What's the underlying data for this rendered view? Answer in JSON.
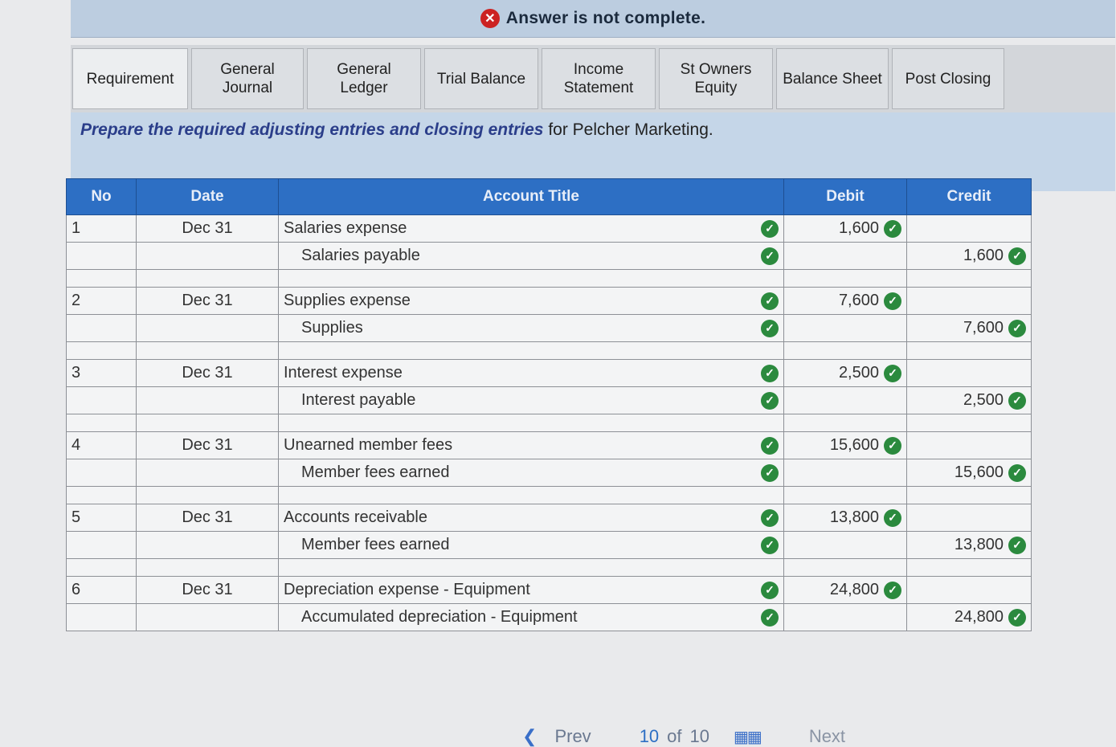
{
  "banner": {
    "message": "Answer is not complete."
  },
  "tabs": [
    {
      "label": "Requirement",
      "active": true
    },
    {
      "label": "General Journal"
    },
    {
      "label": "General Ledger"
    },
    {
      "label": "Trial Balance"
    },
    {
      "label": "Income Statement"
    },
    {
      "label": "St Owners Equity"
    },
    {
      "label": "Balance Sheet"
    },
    {
      "label": "Post Closing"
    }
  ],
  "instructions": {
    "emphasis": "Prepare the required adjusting entries and closing entries",
    "rest": " for Pelcher Marketing."
  },
  "table": {
    "headers": {
      "no": "No",
      "date": "Date",
      "account": "Account Title",
      "debit": "Debit",
      "credit": "Credit"
    },
    "entries": [
      {
        "no": "1",
        "date": "Dec 31",
        "debit_account": "Salaries expense",
        "credit_account": "Salaries payable",
        "amount": "1,600"
      },
      {
        "no": "2",
        "date": "Dec 31",
        "debit_account": "Supplies expense",
        "credit_account": "Supplies",
        "amount": "7,600"
      },
      {
        "no": "3",
        "date": "Dec 31",
        "debit_account": "Interest expense",
        "credit_account": "Interest payable",
        "amount": "2,500"
      },
      {
        "no": "4",
        "date": "Dec 31",
        "debit_account": "Unearned member fees",
        "credit_account": "Member fees earned",
        "amount": "15,600"
      },
      {
        "no": "5",
        "date": "Dec 31",
        "debit_account": "Accounts receivable",
        "credit_account": "Member fees earned",
        "amount": "13,800"
      },
      {
        "no": "6",
        "date": "Dec 31",
        "debit_account": "Depreciation expense - Equipment",
        "credit_account": "Accumulated depreciation - Equipment",
        "amount": "24,800"
      }
    ]
  },
  "pager": {
    "prev": "Prev",
    "current": "10",
    "of": "of",
    "total": "10",
    "next": "Next"
  },
  "icons": {
    "error": "x-circle-icon",
    "check": "check-circle-icon",
    "grid": "grid-icon",
    "prev": "chevron-left-icon"
  },
  "colors": {
    "header_blue": "#2d6fc4",
    "check_green": "#2b8a3e",
    "error_red": "#cc2222"
  }
}
